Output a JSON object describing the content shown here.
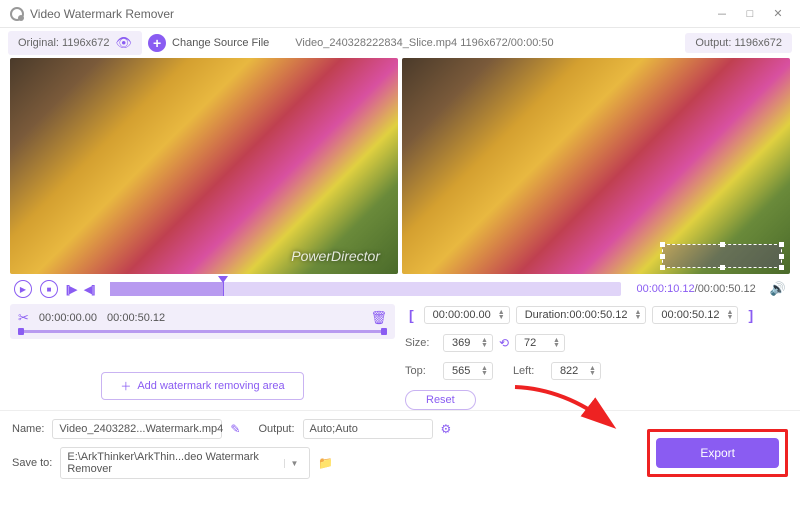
{
  "window": {
    "title": "Video Watermark Remover"
  },
  "toolbar": {
    "original_label": "Original:  1196x672",
    "change_label": "Change Source File",
    "file_info": "Video_240328222834_Slice.mp4    1196x672/00:00:50",
    "output_label": "Output:  1196x672"
  },
  "preview": {
    "watermark_text": "PowerDirector"
  },
  "playback": {
    "current": "00:00:10.12",
    "total": "00:00:50.12"
  },
  "segment": {
    "start": "00:00:00.00",
    "end": "00:00:50.12"
  },
  "add_area_label": "Add watermark removing area",
  "region": {
    "time_start": "00:00:00.00",
    "duration_label": "Duration:00:00:50.12",
    "time_end": "00:00:50.12",
    "size_label": "Size:",
    "width": "369",
    "height": "72",
    "top_label": "Top:",
    "top": "565",
    "left_label": "Left:",
    "left": "822",
    "reset": "Reset"
  },
  "output": {
    "name_label": "Name:",
    "name": "Video_2403282...Watermark.mp4",
    "format_label": "Output:",
    "format": "Auto;Auto",
    "save_label": "Save to:",
    "save_path": "E:\\ArkThinker\\ArkThin...deo Watermark Remover"
  },
  "export_label": "Export"
}
